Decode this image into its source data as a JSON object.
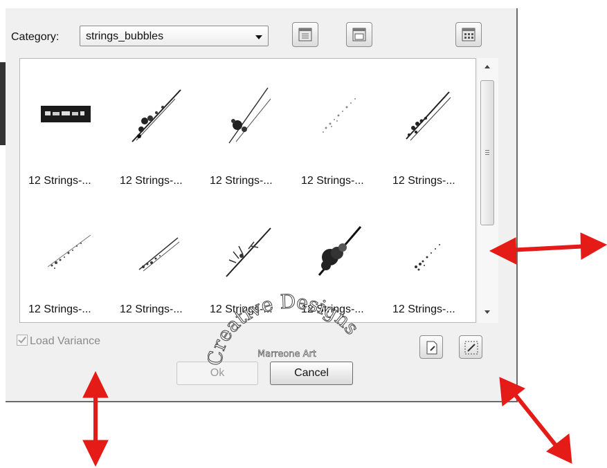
{
  "category": {
    "label": "Category:",
    "value": "strings_bubbles"
  },
  "toolbar": {
    "icons": [
      "list-view-icon",
      "folder-view-icon",
      "grid-view-icon"
    ]
  },
  "items": [
    {
      "label": "12 Strings-..."
    },
    {
      "label": "12 Strings-..."
    },
    {
      "label": "12 Strings-..."
    },
    {
      "label": "12 Strings-..."
    },
    {
      "label": "12 Strings-..."
    },
    {
      "label": "12 Strings-..."
    },
    {
      "label": "12 Strings-..."
    },
    {
      "label": "12 Strings-..."
    },
    {
      "label": "12 Strings-..."
    },
    {
      "label": "12 Strings-..."
    }
  ],
  "options": {
    "load_variance": "Load Variance",
    "load_variance_checked": true
  },
  "buttons": {
    "ok": "Ok",
    "cancel": "Cancel"
  },
  "watermark": {
    "line1": "Creative Designs",
    "line2": "Marreone Art"
  },
  "annotation": {
    "arrow_color": "#e41b17"
  }
}
